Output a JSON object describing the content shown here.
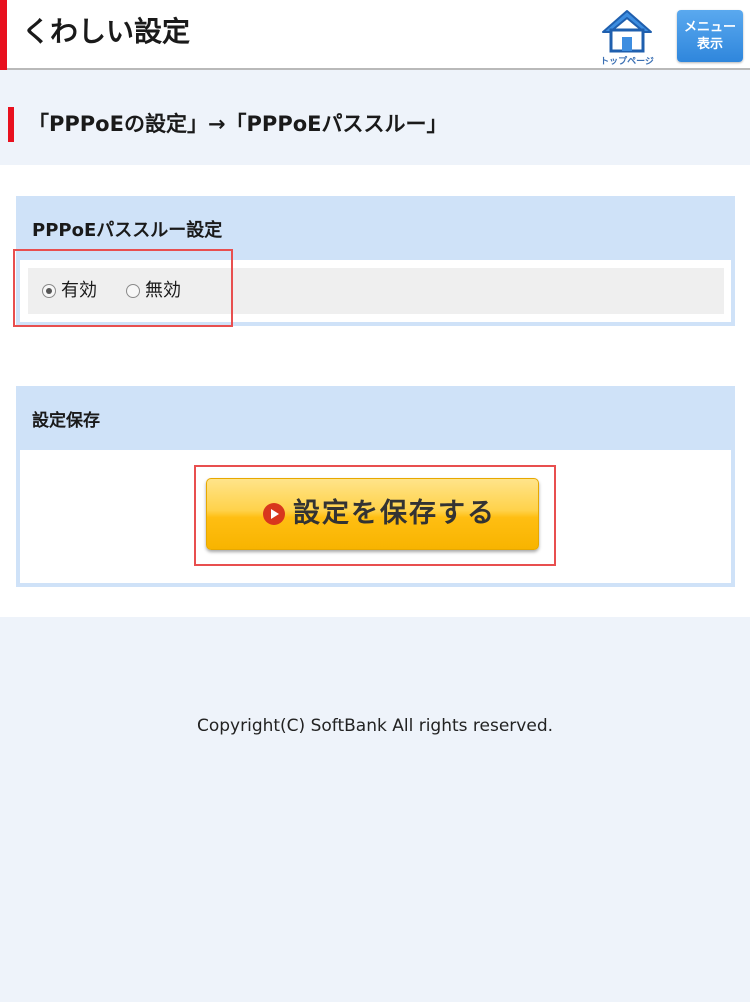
{
  "header": {
    "title": "くわしい設定",
    "home_label": "トップページ",
    "menu_line1": "メニュー",
    "menu_line2": "表示",
    "accent_color": "#e8101e",
    "home_icon": "home-icon"
  },
  "breadcrumb": {
    "text": "「PPPoEの設定」→「PPPoEパススルー」"
  },
  "passthrough_section": {
    "title": "PPPoEパススルー設定",
    "options": [
      {
        "label": "有効",
        "checked": true
      },
      {
        "label": "無効",
        "checked": false
      }
    ]
  },
  "save_section": {
    "title": "設定保存",
    "button_label": "設定を保存する",
    "button_icon": "play-icon"
  },
  "footer": {
    "copyright": "Copyright(C) SoftBank All rights reserved."
  }
}
